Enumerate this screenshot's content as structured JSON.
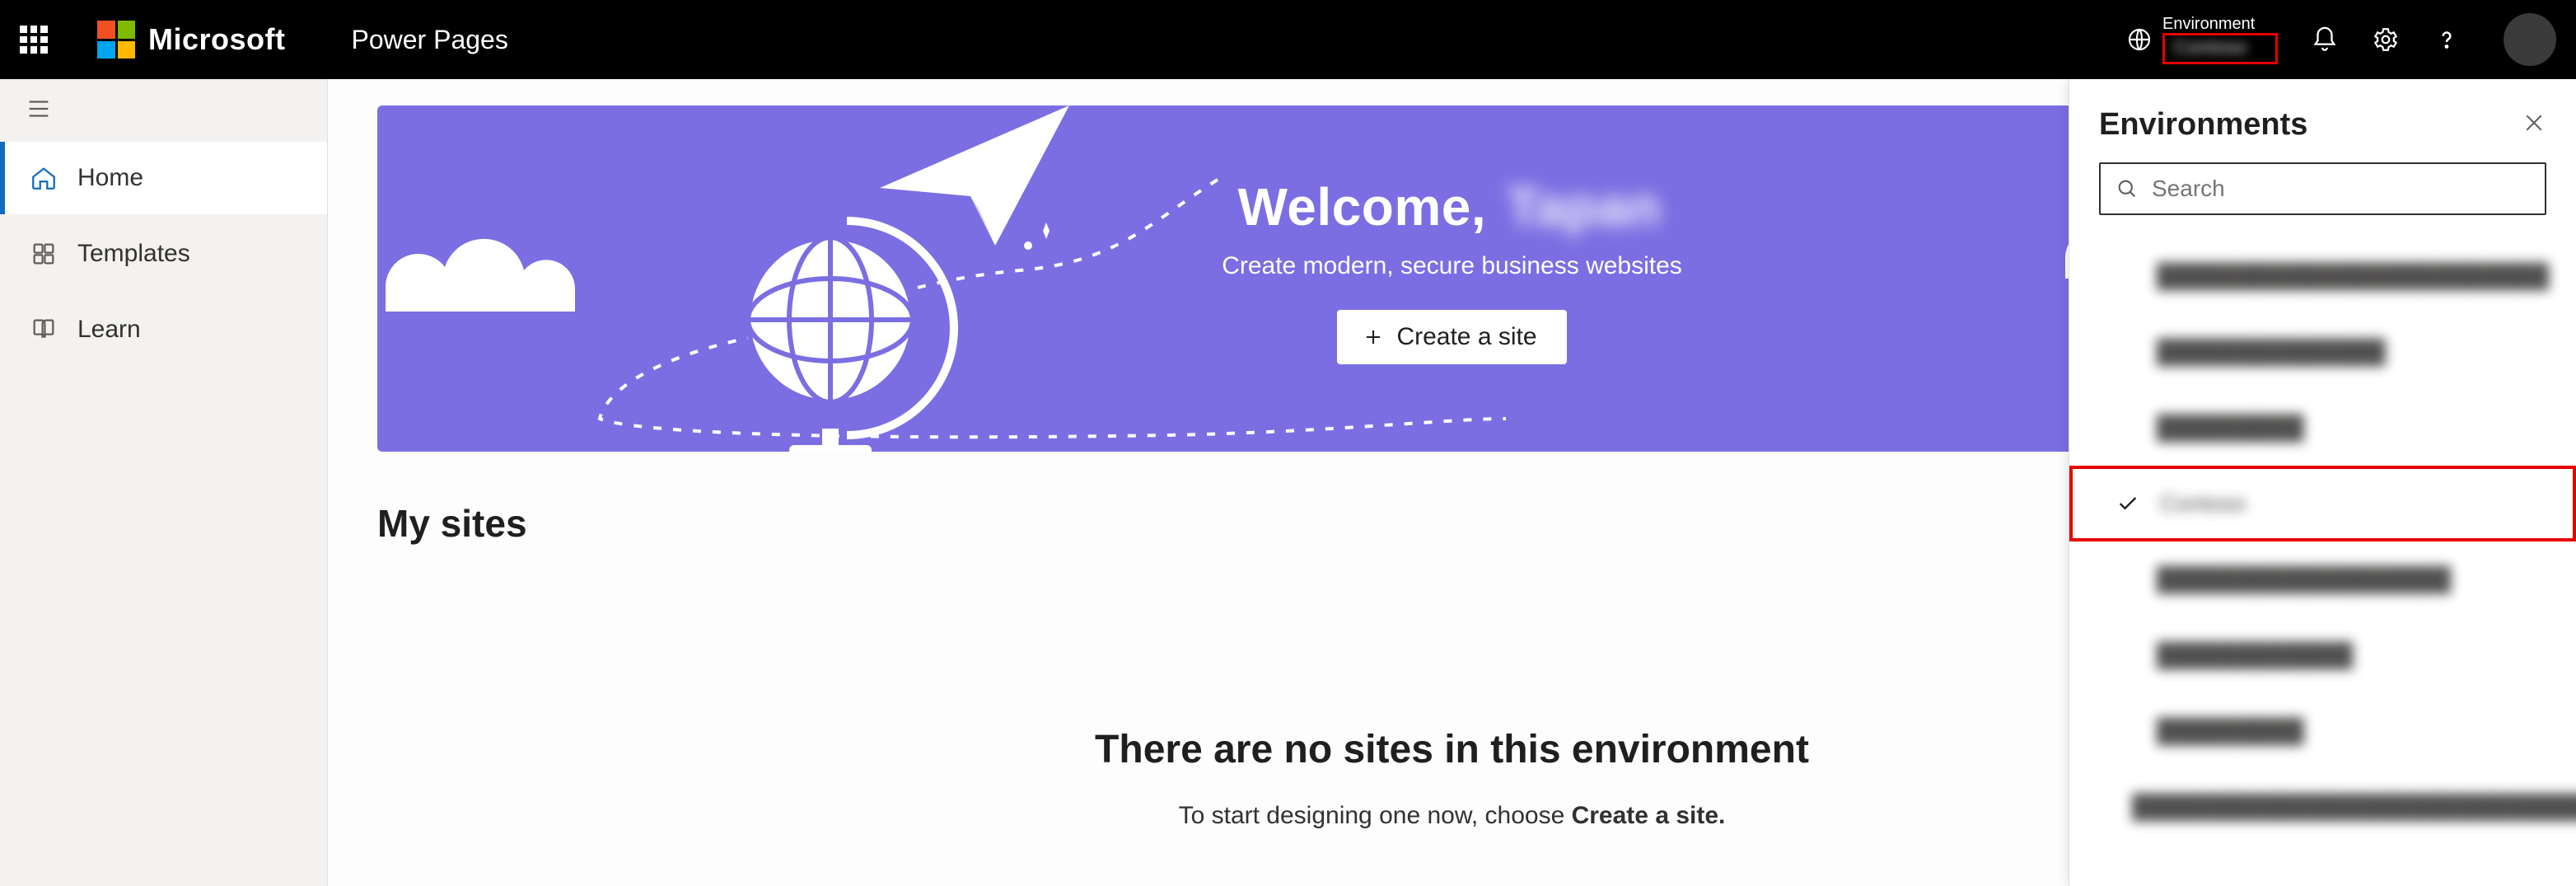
{
  "header": {
    "brand": "Microsoft",
    "product": "Power Pages",
    "environment_label": "Environment",
    "environment_value": "Contoso"
  },
  "sidebar": {
    "items": [
      {
        "label": "Home",
        "icon": "home-icon",
        "active": true
      },
      {
        "label": "Templates",
        "icon": "templates-icon",
        "active": false
      },
      {
        "label": "Learn",
        "icon": "learn-icon",
        "active": false
      }
    ]
  },
  "banner": {
    "welcome_prefix": "Welcome, ",
    "welcome_name": "Tapan",
    "subtitle": "Create modern, secure business websites",
    "create_button": "Create a site"
  },
  "my_sites": {
    "heading": "My sites",
    "empty_heading": "There are no sites in this environment",
    "empty_sub_prefix": "To start designing one now, choose ",
    "empty_sub_bold": "Create a site."
  },
  "env_panel": {
    "title": "Environments",
    "search_placeholder": "Search",
    "items": [
      {
        "name": "████████████████████████",
        "selected": false
      },
      {
        "name": "██████████████",
        "selected": false
      },
      {
        "name": "█████████",
        "selected": false
      },
      {
        "name": "Contoso",
        "selected": true
      },
      {
        "name": "██████████████████",
        "selected": false
      },
      {
        "name": "████████████",
        "selected": false
      },
      {
        "name": "█████████",
        "selected": false
      },
      {
        "name": "████████████████████████████████",
        "selected": false
      }
    ]
  },
  "colors": {
    "accent": "#0f6cbd",
    "banner_bg": "#7b6ee2",
    "highlight_border": "#e60000"
  }
}
